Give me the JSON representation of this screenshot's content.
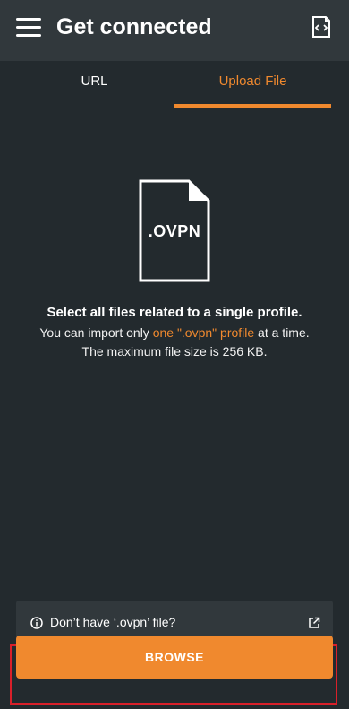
{
  "header": {
    "title": "Get connected",
    "menu_icon": "hamburger-menu-icon",
    "import_icon": "import-profile-icon"
  },
  "tabs": [
    {
      "label": "URL",
      "active": false
    },
    {
      "label": "Upload File",
      "active": true
    }
  ],
  "file_illustration": {
    "ext": ".OVPN",
    "icon": "ovpn-file-icon"
  },
  "message": {
    "title": "Select all files related to a single profile.",
    "line1_prefix": "You can import only ",
    "line1_highlight": "one \".ovpn\" profile",
    "line1_suffix": " at a time.",
    "line2": "The maximum file size is 256 KB."
  },
  "help": {
    "label": "Don’t have ‘.ovpn’ file?",
    "info_icon": "info-icon",
    "external_icon": "external-link-icon"
  },
  "browse": {
    "label": "BROWSE"
  },
  "colors": {
    "accent": "#f0892e",
    "background": "#232a2e",
    "surface": "#31383c",
    "highlight_border": "#d9202a"
  }
}
